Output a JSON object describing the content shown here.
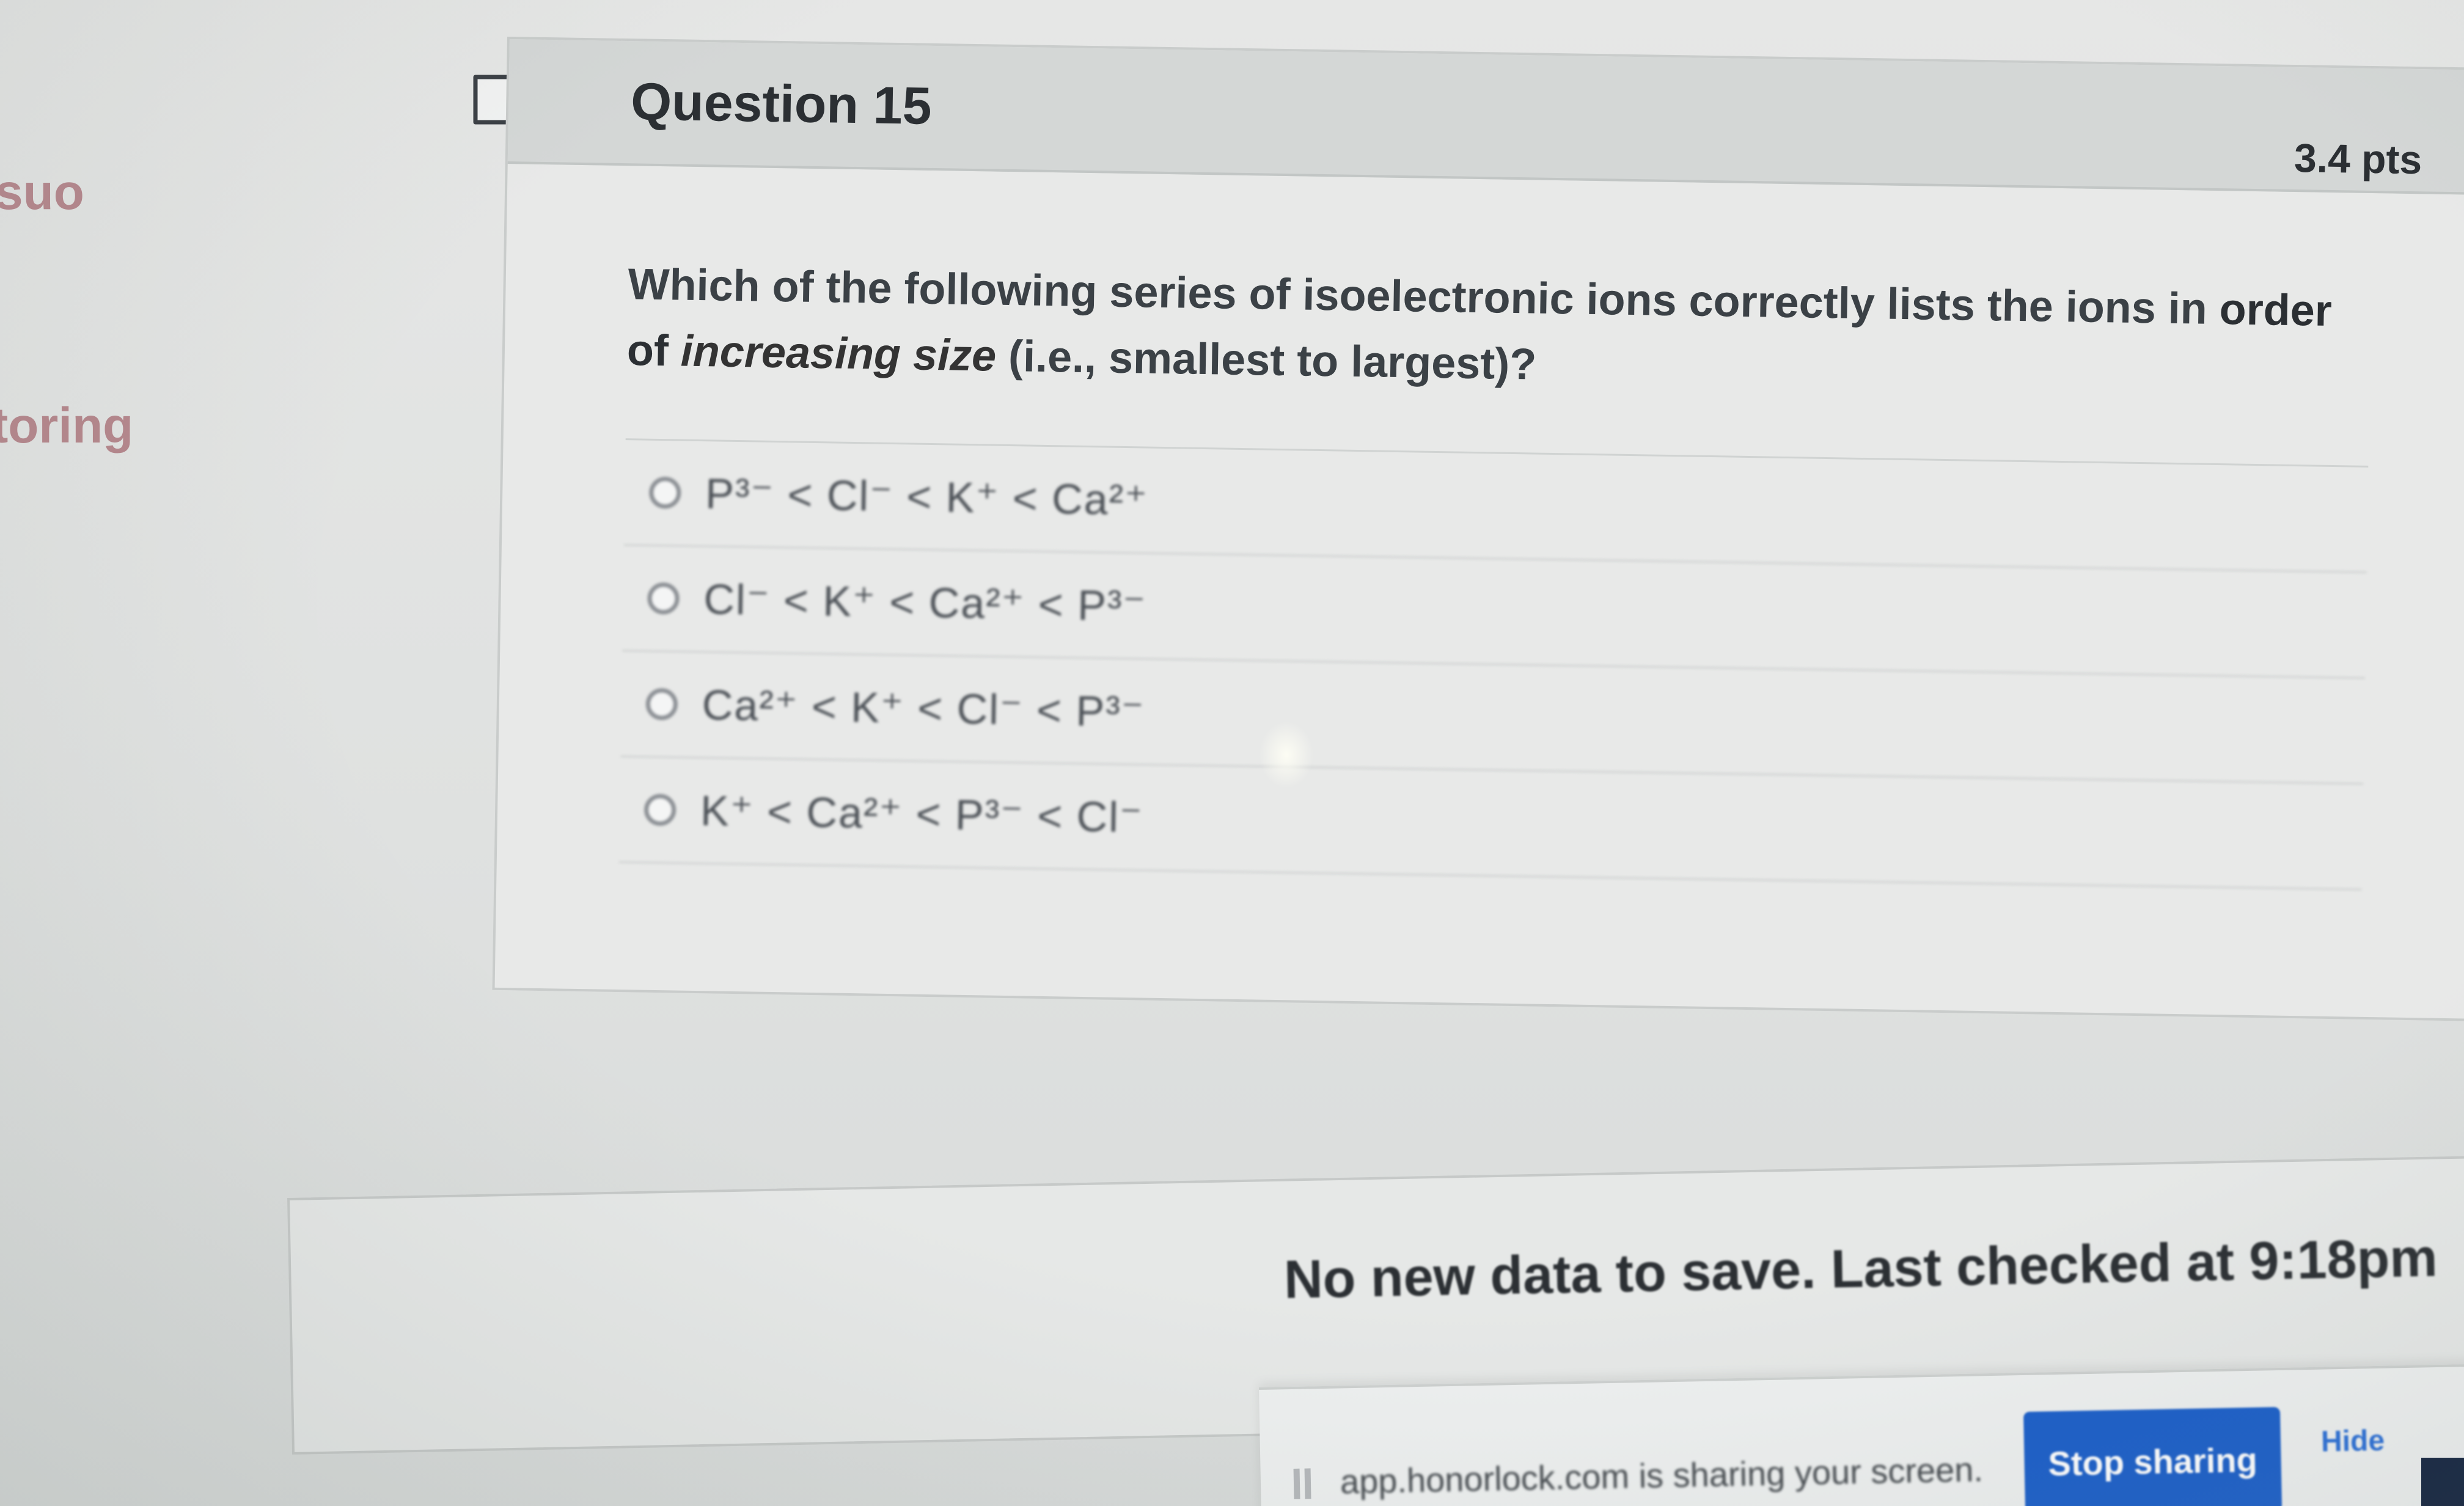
{
  "sidebar": {
    "fragments": [
      "suo",
      "toring"
    ]
  },
  "question": {
    "title": "Question 15",
    "points": "3.4 pts",
    "text_part1": "Which of the following series of isoelectronic ions correctly lists the ions in ",
    "text_emph2": "order of",
    "text_emph": "increasing size",
    "text_part2": " (i.e., smallest to largest)?",
    "answers": [
      {
        "label": "P³⁻ < Cl⁻ < K⁺ < Ca²⁺"
      },
      {
        "label": "Cl⁻ < K⁺ < Ca²⁺ < P³⁻"
      },
      {
        "label": "Ca²⁺ < K⁺ < Cl⁻ < P³⁻"
      },
      {
        "label": "K⁺ < Ca²⁺ < P³⁻ < Cl⁻"
      }
    ]
  },
  "status": {
    "message": "No new data to save. Last checked at 9:18pm"
  },
  "screen_share": {
    "message": "app.honorlock.com is sharing your screen.",
    "stop_label": "Stop sharing",
    "hide_label": "Hide"
  },
  "colors": {
    "stop_button": "#1a5ec9",
    "sidebar_text": "#a35f68"
  }
}
